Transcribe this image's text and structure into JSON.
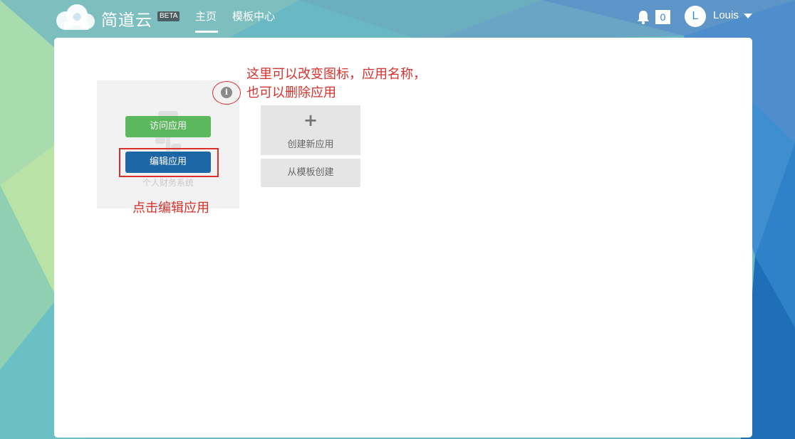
{
  "header": {
    "brand": "简道云",
    "beta_badge": "BETA",
    "nav": [
      {
        "label": "主页",
        "active": true
      },
      {
        "label": "模板中心",
        "active": false
      }
    ],
    "notification_count": "0",
    "user": {
      "initial": "L",
      "name": "Louis"
    }
  },
  "app_card": {
    "visit_label": "访问应用",
    "edit_label": "编辑应用",
    "app_name": "个人财务系统",
    "info_symbol": "i"
  },
  "create": {
    "plus_symbol": "+",
    "new_app_label": "创建新应用",
    "from_template_label": "从模板创建"
  },
  "annotations": {
    "info_note_line1": "这里可以改变图标，应用名称，",
    "info_note_line2": "也可以删除应用",
    "edit_note": "点击编辑应用"
  },
  "colors": {
    "visit_button": "#5cb85c",
    "edit_button": "#1d66a6",
    "annotation": "#d9302b",
    "tile": "#e5e5e5"
  }
}
